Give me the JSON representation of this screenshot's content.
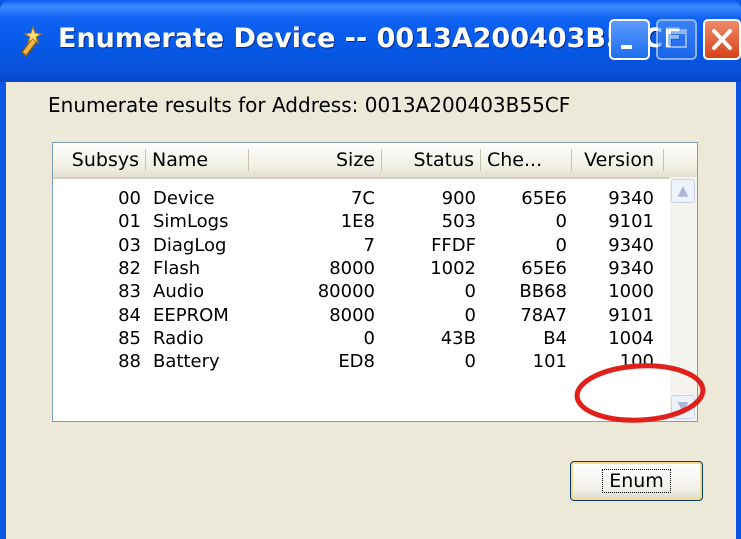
{
  "window": {
    "title": "Enumerate Device -- 0013A200403B55CF"
  },
  "results_label": "Enumerate results for Address: 0013A200403B55CF",
  "table": {
    "columns": [
      "Subsys",
      "Name",
      "Size",
      "Status",
      "Che...",
      "Version"
    ],
    "rows": [
      {
        "subsys": "00",
        "name": "Device",
        "size": "7C",
        "status": "900",
        "checksum": "65E6",
        "version": "9340"
      },
      {
        "subsys": "01",
        "name": "SimLogs",
        "size": "1E8",
        "status": "503",
        "checksum": "0",
        "version": "9101"
      },
      {
        "subsys": "03",
        "name": "DiagLog",
        "size": "7",
        "status": "FFDF",
        "checksum": "0",
        "version": "9340"
      },
      {
        "subsys": "82",
        "name": "Flash",
        "size": "8000",
        "status": "1002",
        "checksum": "65E6",
        "version": "9340"
      },
      {
        "subsys": "83",
        "name": "Audio",
        "size": "80000",
        "status": "0",
        "checksum": "BB68",
        "version": "1000"
      },
      {
        "subsys": "84",
        "name": "EEPROM",
        "size": "8000",
        "status": "0",
        "checksum": "78A7",
        "version": "9101"
      },
      {
        "subsys": "85",
        "name": "Radio",
        "size": "0",
        "status": "43B",
        "checksum": "B4",
        "version": "1004"
      },
      {
        "subsys": "88",
        "name": "Battery",
        "size": "ED8",
        "status": "0",
        "checksum": "101",
        "version": "100"
      }
    ]
  },
  "buttons": {
    "enum_label": "Enum"
  },
  "icons": {
    "app": "sparkle-tool-icon",
    "minimize": "minimize-icon",
    "maximize": "maximize-icon",
    "close": "close-icon",
    "scroll_up": "chevron-up-icon",
    "scroll_down": "chevron-down-icon"
  },
  "colors": {
    "titlebar": "#0558e6",
    "client_bg": "#ece9d8",
    "close_button": "#d6421b",
    "annotation": "#e0201a"
  },
  "annotation": {
    "type": "ellipse",
    "highlights": "Battery version value"
  }
}
